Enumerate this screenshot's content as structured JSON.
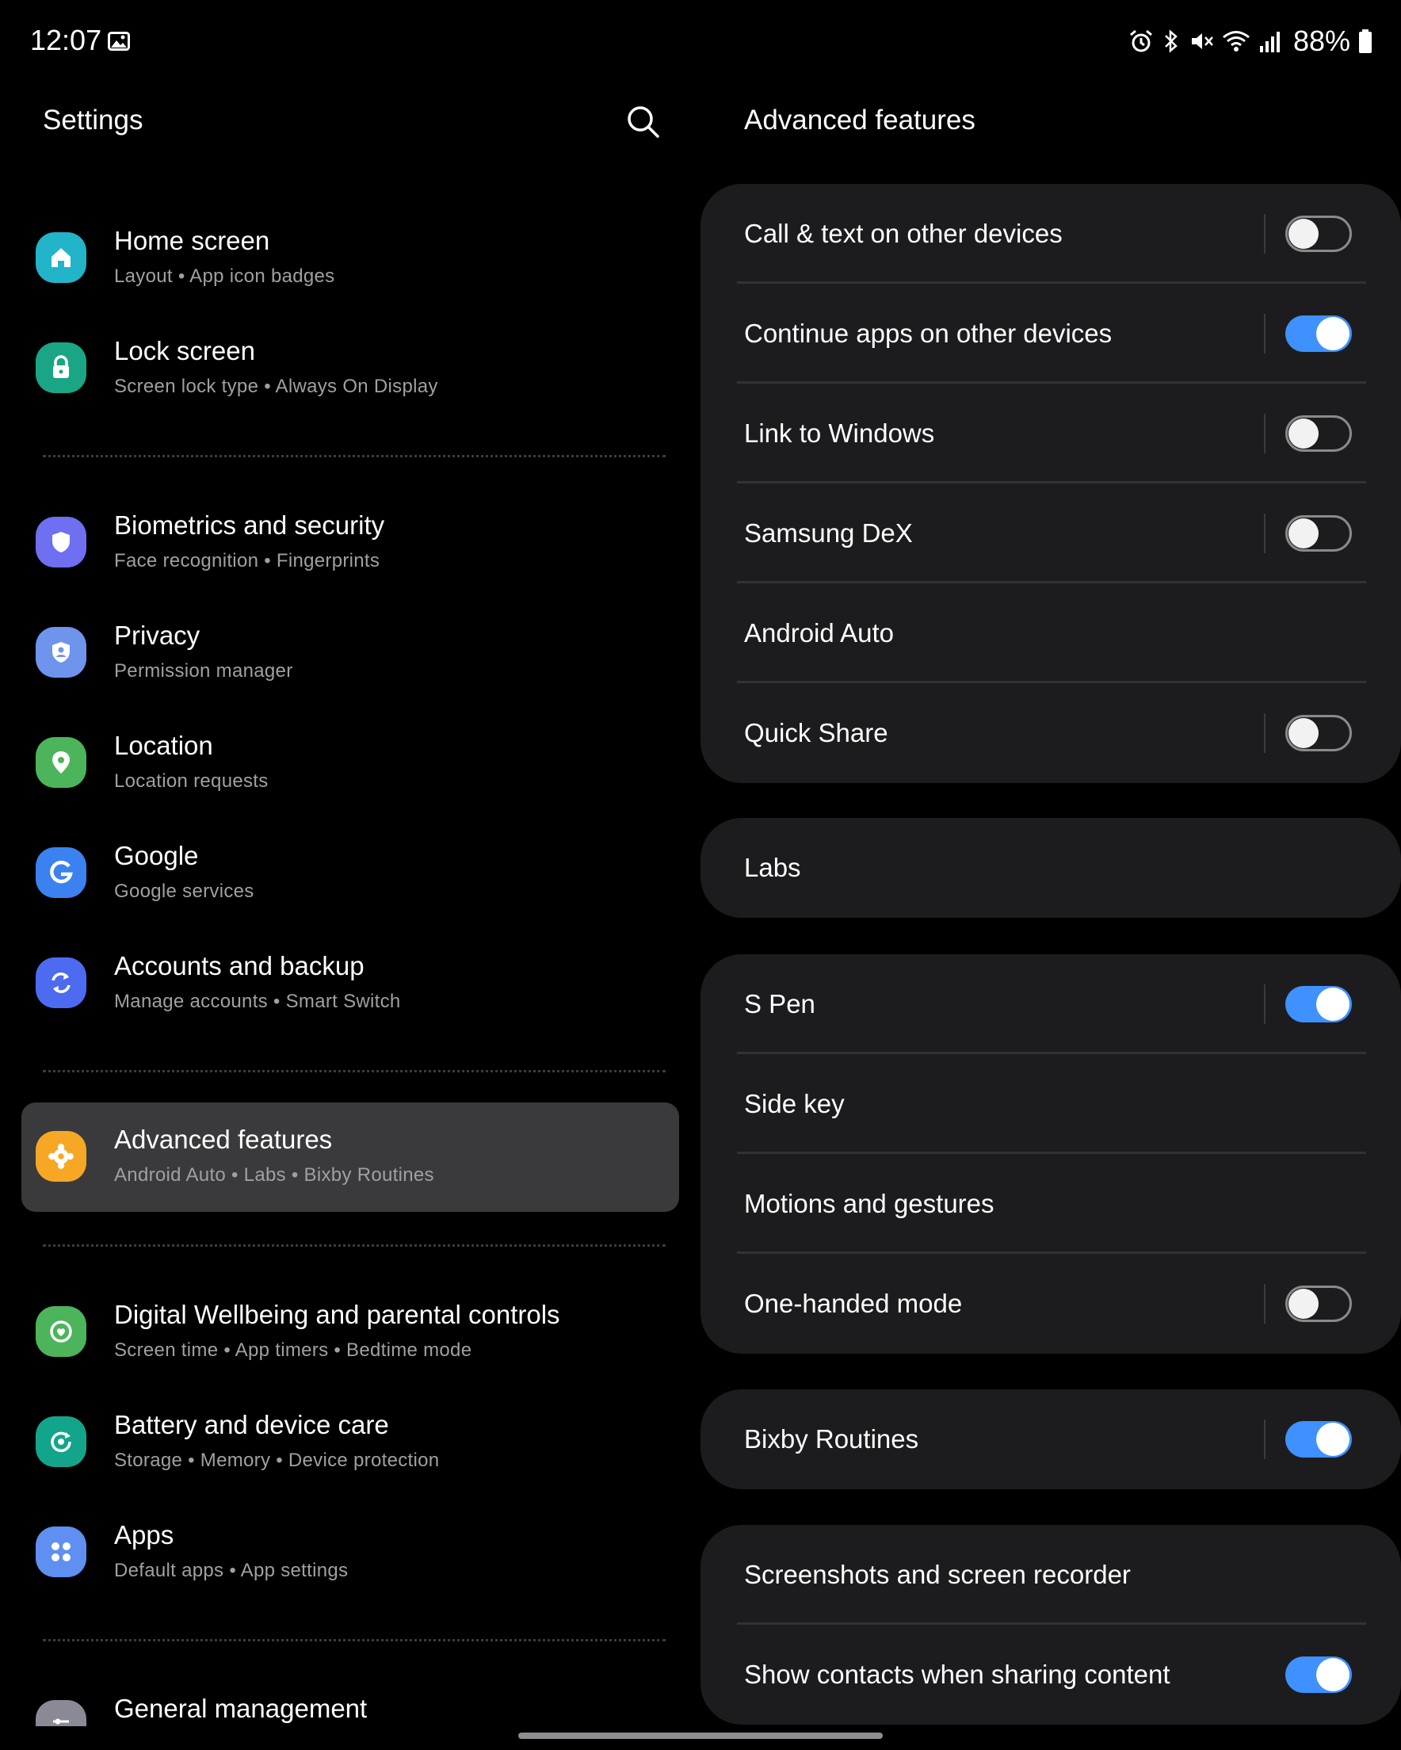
{
  "status_bar": {
    "time": "12:07",
    "battery": "88%",
    "icons": [
      "image-icon",
      "alarm-icon",
      "bluetooth-icon",
      "mute-icon",
      "wifi-icon",
      "signal-icon",
      "battery-icon"
    ]
  },
  "left_panel": {
    "title": "Settings",
    "items": [
      {
        "title": "Home screen",
        "subtitle": "Layout  •  App icon badges",
        "icon": "home-icon",
        "color": "#22b4c9"
      },
      {
        "title": "Lock screen",
        "subtitle": "Screen lock type  •  Always On Display",
        "icon": "lock-icon",
        "color": "#1aa685"
      },
      {
        "title": "Biometrics and security",
        "subtitle": "Face recognition  •  Fingerprints",
        "icon": "shield-icon",
        "color": "#6f6ff1"
      },
      {
        "title": "Privacy",
        "subtitle": "Permission manager",
        "icon": "privacy-icon",
        "color": "#6f94ee"
      },
      {
        "title": "Location",
        "subtitle": "Location requests",
        "icon": "location-pin-icon",
        "color": "#4cb45a"
      },
      {
        "title": "Google",
        "subtitle": "Google services",
        "icon": "google-icon",
        "color": "#3b82f0"
      },
      {
        "title": "Accounts and backup",
        "subtitle": "Manage accounts  •  Smart Switch",
        "icon": "sync-icon",
        "color": "#4d6bf0"
      },
      {
        "title": "Advanced features",
        "subtitle": "Android Auto  •  Labs  •  Bixby Routines",
        "icon": "puzzle-gear-icon",
        "color": "#f6a824",
        "selected": true
      },
      {
        "title": "Digital Wellbeing and parental controls",
        "subtitle": "Screen time  •  App timers  •  Bedtime mode",
        "icon": "wellbeing-icon",
        "color": "#4cb45a"
      },
      {
        "title": "Battery and device care",
        "subtitle": "Storage  •  Memory  •  Device protection",
        "icon": "device-care-icon",
        "color": "#13a58c"
      },
      {
        "title": "Apps",
        "subtitle": "Default apps  •  App settings",
        "icon": "apps-grid-icon",
        "color": "#5f8ff0"
      },
      {
        "title": "General management",
        "subtitle": "",
        "icon": "general-management-icon",
        "color": "#8a8a96"
      }
    ]
  },
  "right_panel": {
    "title": "Advanced features",
    "groups": [
      [
        {
          "label": "Call & text on other devices",
          "toggle": "off"
        },
        {
          "label": "Continue apps on other devices",
          "toggle": "on"
        },
        {
          "label": "Link to Windows",
          "toggle": "off"
        },
        {
          "label": "Samsung DeX",
          "toggle": "off"
        },
        {
          "label": "Android Auto",
          "toggle": null
        },
        {
          "label": "Quick Share",
          "toggle": "off"
        }
      ],
      [
        {
          "label": "Labs",
          "toggle": null
        }
      ],
      [
        {
          "label": "S Pen",
          "toggle": "on"
        },
        {
          "label": "Side key",
          "toggle": null
        },
        {
          "label": "Motions and gestures",
          "toggle": null
        },
        {
          "label": "One-handed mode",
          "toggle": "off"
        }
      ],
      [
        {
          "label": "Bixby Routines",
          "toggle": "on"
        }
      ],
      [
        {
          "label": "Screenshots and screen recorder",
          "toggle": null
        },
        {
          "label": "Show contacts when sharing content",
          "toggle": "on"
        }
      ]
    ]
  },
  "colors": {
    "background": "#000000",
    "card": "#1c1c1e",
    "selected_item": "#3a3a3c",
    "toggle_on": "#3e91ff",
    "subtitle_text": "#a0a0a4"
  }
}
